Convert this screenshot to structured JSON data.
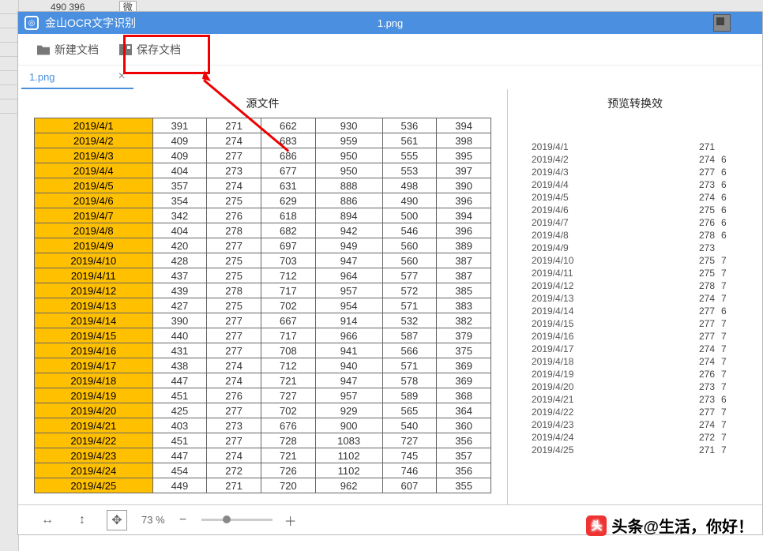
{
  "titlebar": {
    "app_name": "金山OCR文字识别",
    "filename": "1.png"
  },
  "toolbar": {
    "new_doc": "新建文档",
    "save_doc": "保存文档"
  },
  "tab": {
    "name": "1.png"
  },
  "panels": {
    "source_title": "源文件",
    "preview_title": "预览转换效"
  },
  "source_rows": [
    [
      "2019/4/1",
      "391",
      "271",
      "662",
      "930",
      "536",
      "394"
    ],
    [
      "2019/4/2",
      "409",
      "274",
      "683",
      "959",
      "561",
      "398"
    ],
    [
      "2019/4/3",
      "409",
      "277",
      "686",
      "950",
      "555",
      "395"
    ],
    [
      "2019/4/4",
      "404",
      "273",
      "677",
      "950",
      "553",
      "397"
    ],
    [
      "2019/4/5",
      "357",
      "274",
      "631",
      "888",
      "498",
      "390"
    ],
    [
      "2019/4/6",
      "354",
      "275",
      "629",
      "886",
      "490",
      "396"
    ],
    [
      "2019/4/7",
      "342",
      "276",
      "618",
      "894",
      "500",
      "394"
    ],
    [
      "2019/4/8",
      "404",
      "278",
      "682",
      "942",
      "546",
      "396"
    ],
    [
      "2019/4/9",
      "420",
      "277",
      "697",
      "949",
      "560",
      "389"
    ],
    [
      "2019/4/10",
      "428",
      "275",
      "703",
      "947",
      "560",
      "387"
    ],
    [
      "2019/4/11",
      "437",
      "275",
      "712",
      "964",
      "577",
      "387"
    ],
    [
      "2019/4/12",
      "439",
      "278",
      "717",
      "957",
      "572",
      "385"
    ],
    [
      "2019/4/13",
      "427",
      "275",
      "702",
      "954",
      "571",
      "383"
    ],
    [
      "2019/4/14",
      "390",
      "277",
      "667",
      "914",
      "532",
      "382"
    ],
    [
      "2019/4/15",
      "440",
      "277",
      "717",
      "966",
      "587",
      "379"
    ],
    [
      "2019/4/16",
      "431",
      "277",
      "708",
      "941",
      "566",
      "375"
    ],
    [
      "2019/4/17",
      "438",
      "274",
      "712",
      "940",
      "571",
      "369"
    ],
    [
      "2019/4/18",
      "447",
      "274",
      "721",
      "947",
      "578",
      "369"
    ],
    [
      "2019/4/19",
      "451",
      "276",
      "727",
      "957",
      "589",
      "368"
    ],
    [
      "2019/4/20",
      "425",
      "277",
      "702",
      "929",
      "565",
      "364"
    ],
    [
      "2019/4/21",
      "403",
      "273",
      "676",
      "900",
      "540",
      "360"
    ],
    [
      "2019/4/22",
      "451",
      "277",
      "728",
      "1083",
      "727",
      "356"
    ],
    [
      "2019/4/23",
      "447",
      "274",
      "721",
      "1102",
      "745",
      "357"
    ],
    [
      "2019/4/24",
      "454",
      "272",
      "726",
      "1102",
      "746",
      "356"
    ],
    [
      "2019/4/25",
      "449",
      "271",
      "720",
      "962",
      "607",
      "355"
    ]
  ],
  "preview_rows": [
    {
      "d": "2019/4/1",
      "v": "271",
      "e": ""
    },
    {
      "d": "2019/4/2",
      "v": "274",
      "e": "6"
    },
    {
      "d": "2019/4/3",
      "v": "277",
      "e": "6"
    },
    {
      "d": "2019/4/4",
      "v": "273",
      "e": "6"
    },
    {
      "d": "2019/4/5",
      "v": "274",
      "e": "6"
    },
    {
      "d": "2019/4/6",
      "v": "275",
      "e": "6"
    },
    {
      "d": "2019/4/7",
      "v": "276",
      "e": "6"
    },
    {
      "d": "2019/4/8",
      "v": "278",
      "e": "6"
    },
    {
      "d": "2019/4/9",
      "v": "273",
      "e": ""
    },
    {
      "d": "2019/4/10",
      "v": "275",
      "e": "7"
    },
    {
      "d": "2019/4/11",
      "v": "275",
      "e": "7"
    },
    {
      "d": "2019/4/12",
      "v": "278",
      "e": "7"
    },
    {
      "d": "2019/4/13",
      "v": "274",
      "e": "7"
    },
    {
      "d": "2019/4/14",
      "v": "277",
      "e": "6"
    },
    {
      "d": "2019/4/15",
      "v": "277",
      "e": "7"
    },
    {
      "d": "2019/4/16",
      "v": "277",
      "e": "7"
    },
    {
      "d": "2019/4/17",
      "v": "274",
      "e": "7"
    },
    {
      "d": "2019/4/18",
      "v": "274",
      "e": "7"
    },
    {
      "d": "2019/4/19",
      "v": "276",
      "e": "7"
    },
    {
      "d": "2019/4/20",
      "v": "273",
      "e": "7"
    },
    {
      "d": "2019/4/21",
      "v": "273",
      "e": "6"
    },
    {
      "d": "2019/4/22",
      "v": "277",
      "e": "7"
    },
    {
      "d": "2019/4/23",
      "v": "274",
      "e": "7"
    },
    {
      "d": "2019/4/24",
      "v": "272",
      "e": "7"
    },
    {
      "d": "2019/4/25",
      "v": "271",
      "e": "7"
    }
  ],
  "bottombar": {
    "zoom": "73 %"
  },
  "bg": {
    "top_vals": "490      396",
    "top_btn": "微"
  },
  "watermark": {
    "logo": "头",
    "text": "头条@生活，你好！"
  }
}
